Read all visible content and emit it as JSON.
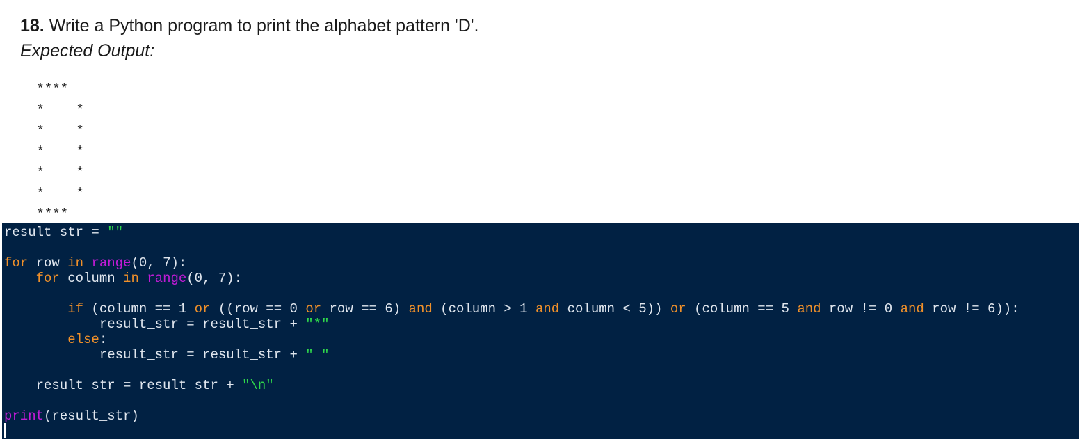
{
  "question": {
    "number": "18.",
    "text": " Write a Python program to print the alphabet pattern 'D'."
  },
  "expected_label": "Expected Output:",
  "expected_output": " ****\n *    *\n *    *\n *    *\n *    *\n *    *\n ****",
  "colors": {
    "editor_background": "#012143",
    "keyword": "#f0902a",
    "builtin": "#c11bd6",
    "string": "#2fd84b",
    "plain_code": "#e0e6ee"
  },
  "code_lines": [
    [
      {
        "t": "result_str = ",
        "c": "p"
      },
      {
        "t": "\"\"",
        "c": "st"
      }
    ],
    [],
    [
      {
        "t": "for",
        "c": "kw"
      },
      {
        "t": " row ",
        "c": "p"
      },
      {
        "t": "in",
        "c": "kw"
      },
      {
        "t": " ",
        "c": "p"
      },
      {
        "t": "range",
        "c": "bi"
      },
      {
        "t": "(0, 7):",
        "c": "p"
      }
    ],
    [
      {
        "t": "    ",
        "c": "p"
      },
      {
        "t": "for",
        "c": "kw"
      },
      {
        "t": " column ",
        "c": "p"
      },
      {
        "t": "in",
        "c": "kw"
      },
      {
        "t": " ",
        "c": "p"
      },
      {
        "t": "range",
        "c": "bi"
      },
      {
        "t": "(0, 7):",
        "c": "p"
      }
    ],
    [],
    [
      {
        "t": "        ",
        "c": "p"
      },
      {
        "t": "if",
        "c": "kw"
      },
      {
        "t": " (column == 1 ",
        "c": "p"
      },
      {
        "t": "or",
        "c": "kw"
      },
      {
        "t": " ((row == 0 ",
        "c": "p"
      },
      {
        "t": "or",
        "c": "kw"
      },
      {
        "t": " row == 6) ",
        "c": "p"
      },
      {
        "t": "and",
        "c": "kw"
      },
      {
        "t": " (column > 1 ",
        "c": "p"
      },
      {
        "t": "and",
        "c": "kw"
      },
      {
        "t": " column < 5)) ",
        "c": "p"
      },
      {
        "t": "or",
        "c": "kw"
      },
      {
        "t": " (column == 5 ",
        "c": "p"
      },
      {
        "t": "and",
        "c": "kw"
      },
      {
        "t": " row != 0 ",
        "c": "p"
      },
      {
        "t": "and",
        "c": "kw"
      },
      {
        "t": " row != 6)):",
        "c": "p"
      }
    ],
    [
      {
        "t": "            result_str = result_str + ",
        "c": "p"
      },
      {
        "t": "\"*\"",
        "c": "st"
      }
    ],
    [
      {
        "t": "        ",
        "c": "p"
      },
      {
        "t": "else",
        "c": "kw"
      },
      {
        "t": ":",
        "c": "p"
      }
    ],
    [
      {
        "t": "            result_str = result_str + ",
        "c": "p"
      },
      {
        "t": "\" \"",
        "c": "st"
      }
    ],
    [],
    [
      {
        "t": "    result_str = result_str + ",
        "c": "p"
      },
      {
        "t": "\"\\n\"",
        "c": "st"
      }
    ],
    [],
    [
      {
        "t": "print",
        "c": "bi"
      },
      {
        "t": "(result_str)",
        "c": "p"
      }
    ]
  ]
}
